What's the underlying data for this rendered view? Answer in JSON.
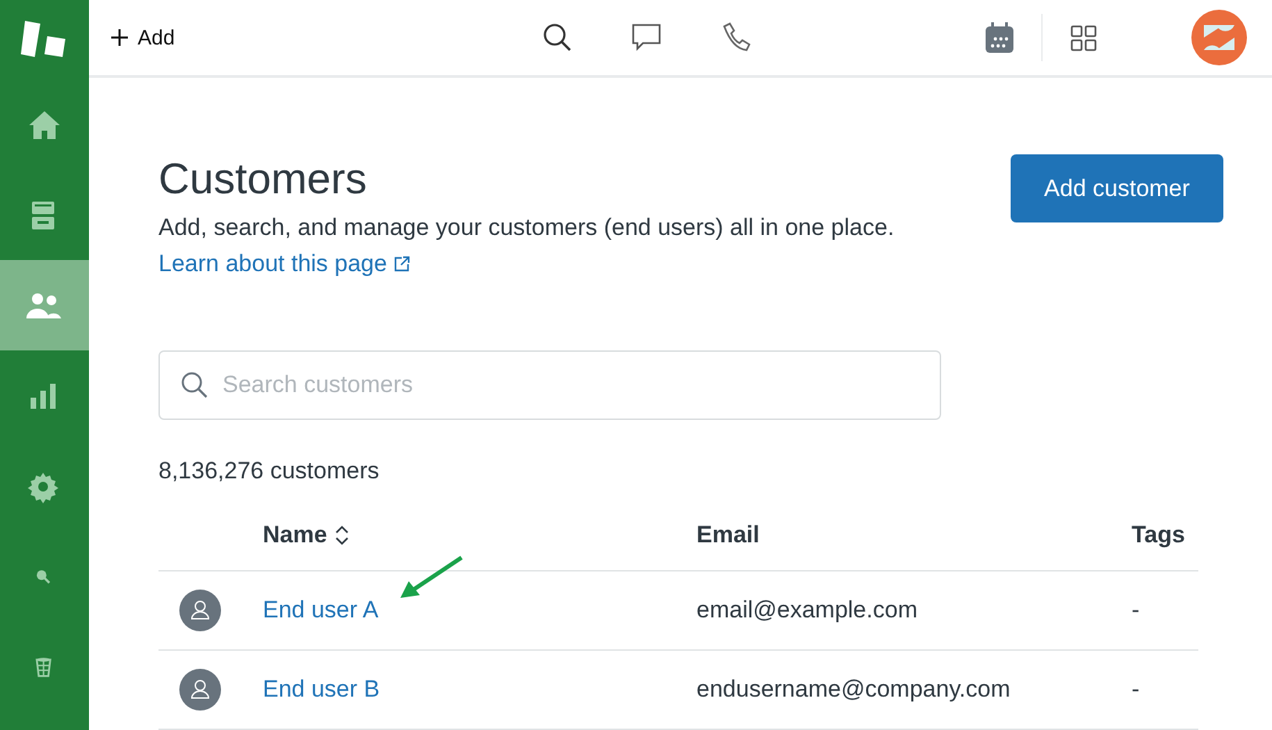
{
  "sidebar": {
    "items": [
      {
        "selected": false
      },
      {
        "selected": false
      },
      {
        "selected": true
      },
      {
        "selected": false
      },
      {
        "selected": false
      },
      {
        "selected": false
      },
      {
        "selected": false
      }
    ]
  },
  "topbar": {
    "add_label": "Add"
  },
  "page": {
    "title": "Customers",
    "description": "Add, search, and manage your customers (end users) all in one place.",
    "learn_link": "Learn about this page",
    "add_button": "Add customer"
  },
  "search": {
    "placeholder": "Search customers"
  },
  "count": "8,136,276 customers",
  "table": {
    "columns": [
      "Name",
      "Email",
      "Tags"
    ],
    "rows": [
      {
        "name": "End user A",
        "email": "email@example.com",
        "tags": "-"
      },
      {
        "name": "End user B",
        "email": "endusername@company.com",
        "tags": "-"
      }
    ]
  }
}
